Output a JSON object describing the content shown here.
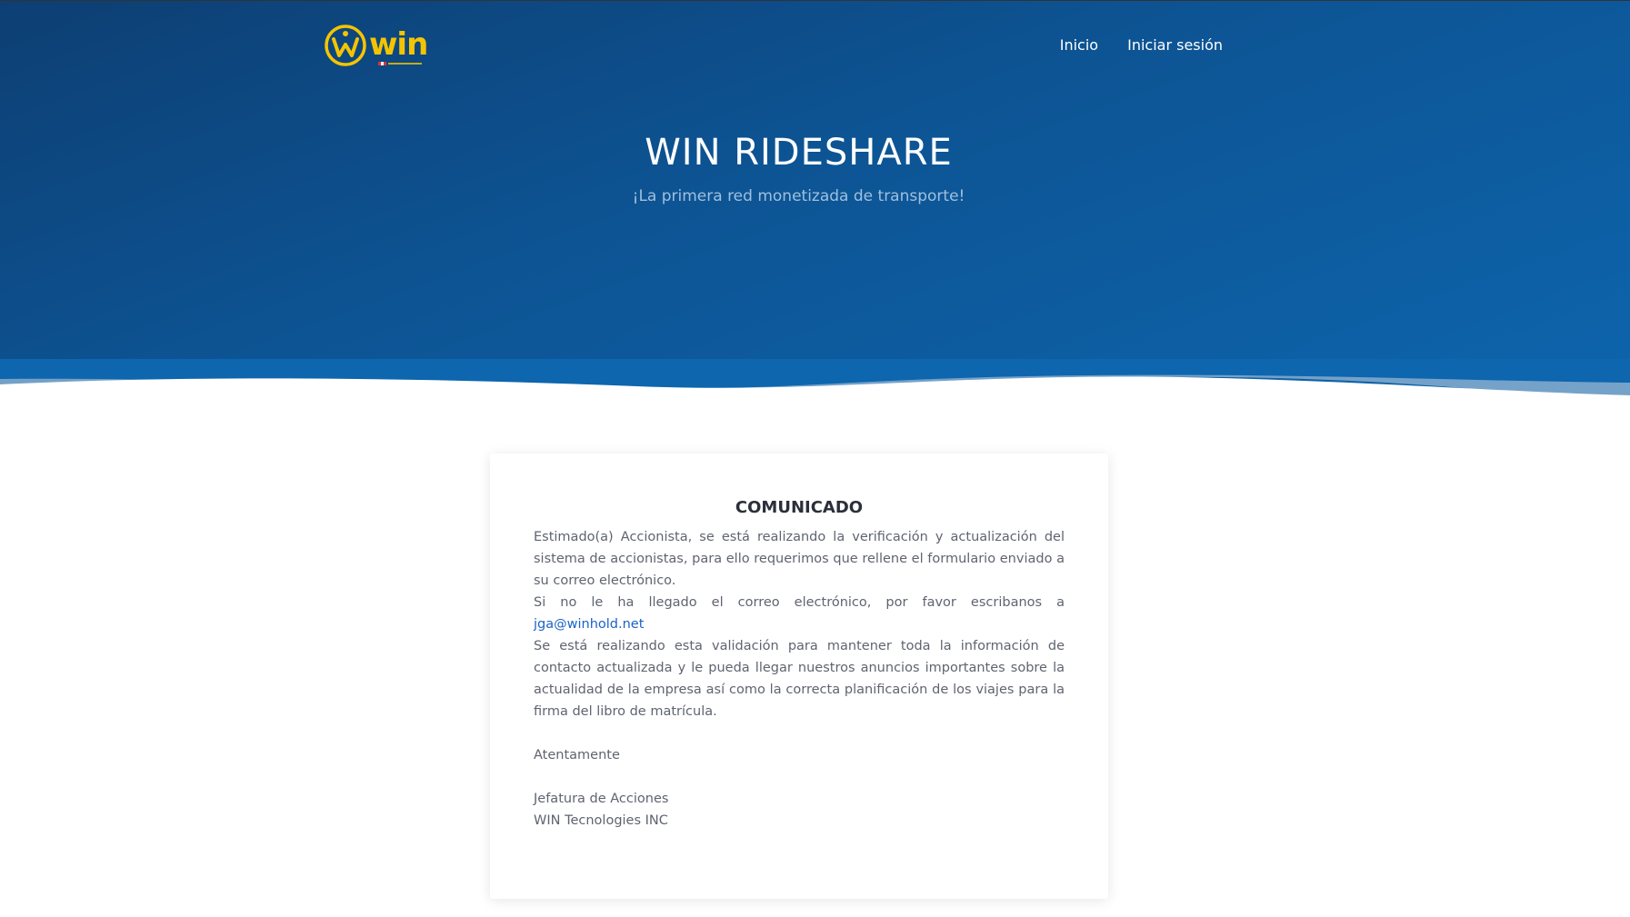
{
  "header": {
    "logo_text": "win",
    "nav": [
      {
        "label": "Inicio"
      },
      {
        "label": "Iniciar sesión"
      }
    ]
  },
  "hero": {
    "title": "WIN RIDESHARE",
    "subtitle": "¡La primera red monetizada de transporte!"
  },
  "notice": {
    "title": "COMUNICADO",
    "paragraph1": "Estimado(a) Accionista, se está realizando la verificación y actualización del sistema de accionistas, para ello requerimos que rellene el formulario enviado a su correo electrónico.",
    "paragraph2_text": "Si no le ha llegado el correo electrónico, por favor escribanos a",
    "email_link": "jga@winhold.net",
    "paragraph3": "Se está realizando esta validación para mantener toda la información de contacto actualizada y le pueda llegar nuestros anuncios importantes sobre la actualidad de la empresa así como la correcta planificación de los viajes para la firma del libro de matrícula.",
    "closing": "Atentamente",
    "signature_line1": "Jefatura de Acciones",
    "signature_line2": "WIN Tecnologies INC"
  },
  "colors": {
    "hero_dark": "#0d3f73",
    "hero_light": "#0d65ad",
    "logo_yellow": "#f5c400",
    "link_blue": "#1a63c7",
    "text_gray": "#5f6470"
  }
}
